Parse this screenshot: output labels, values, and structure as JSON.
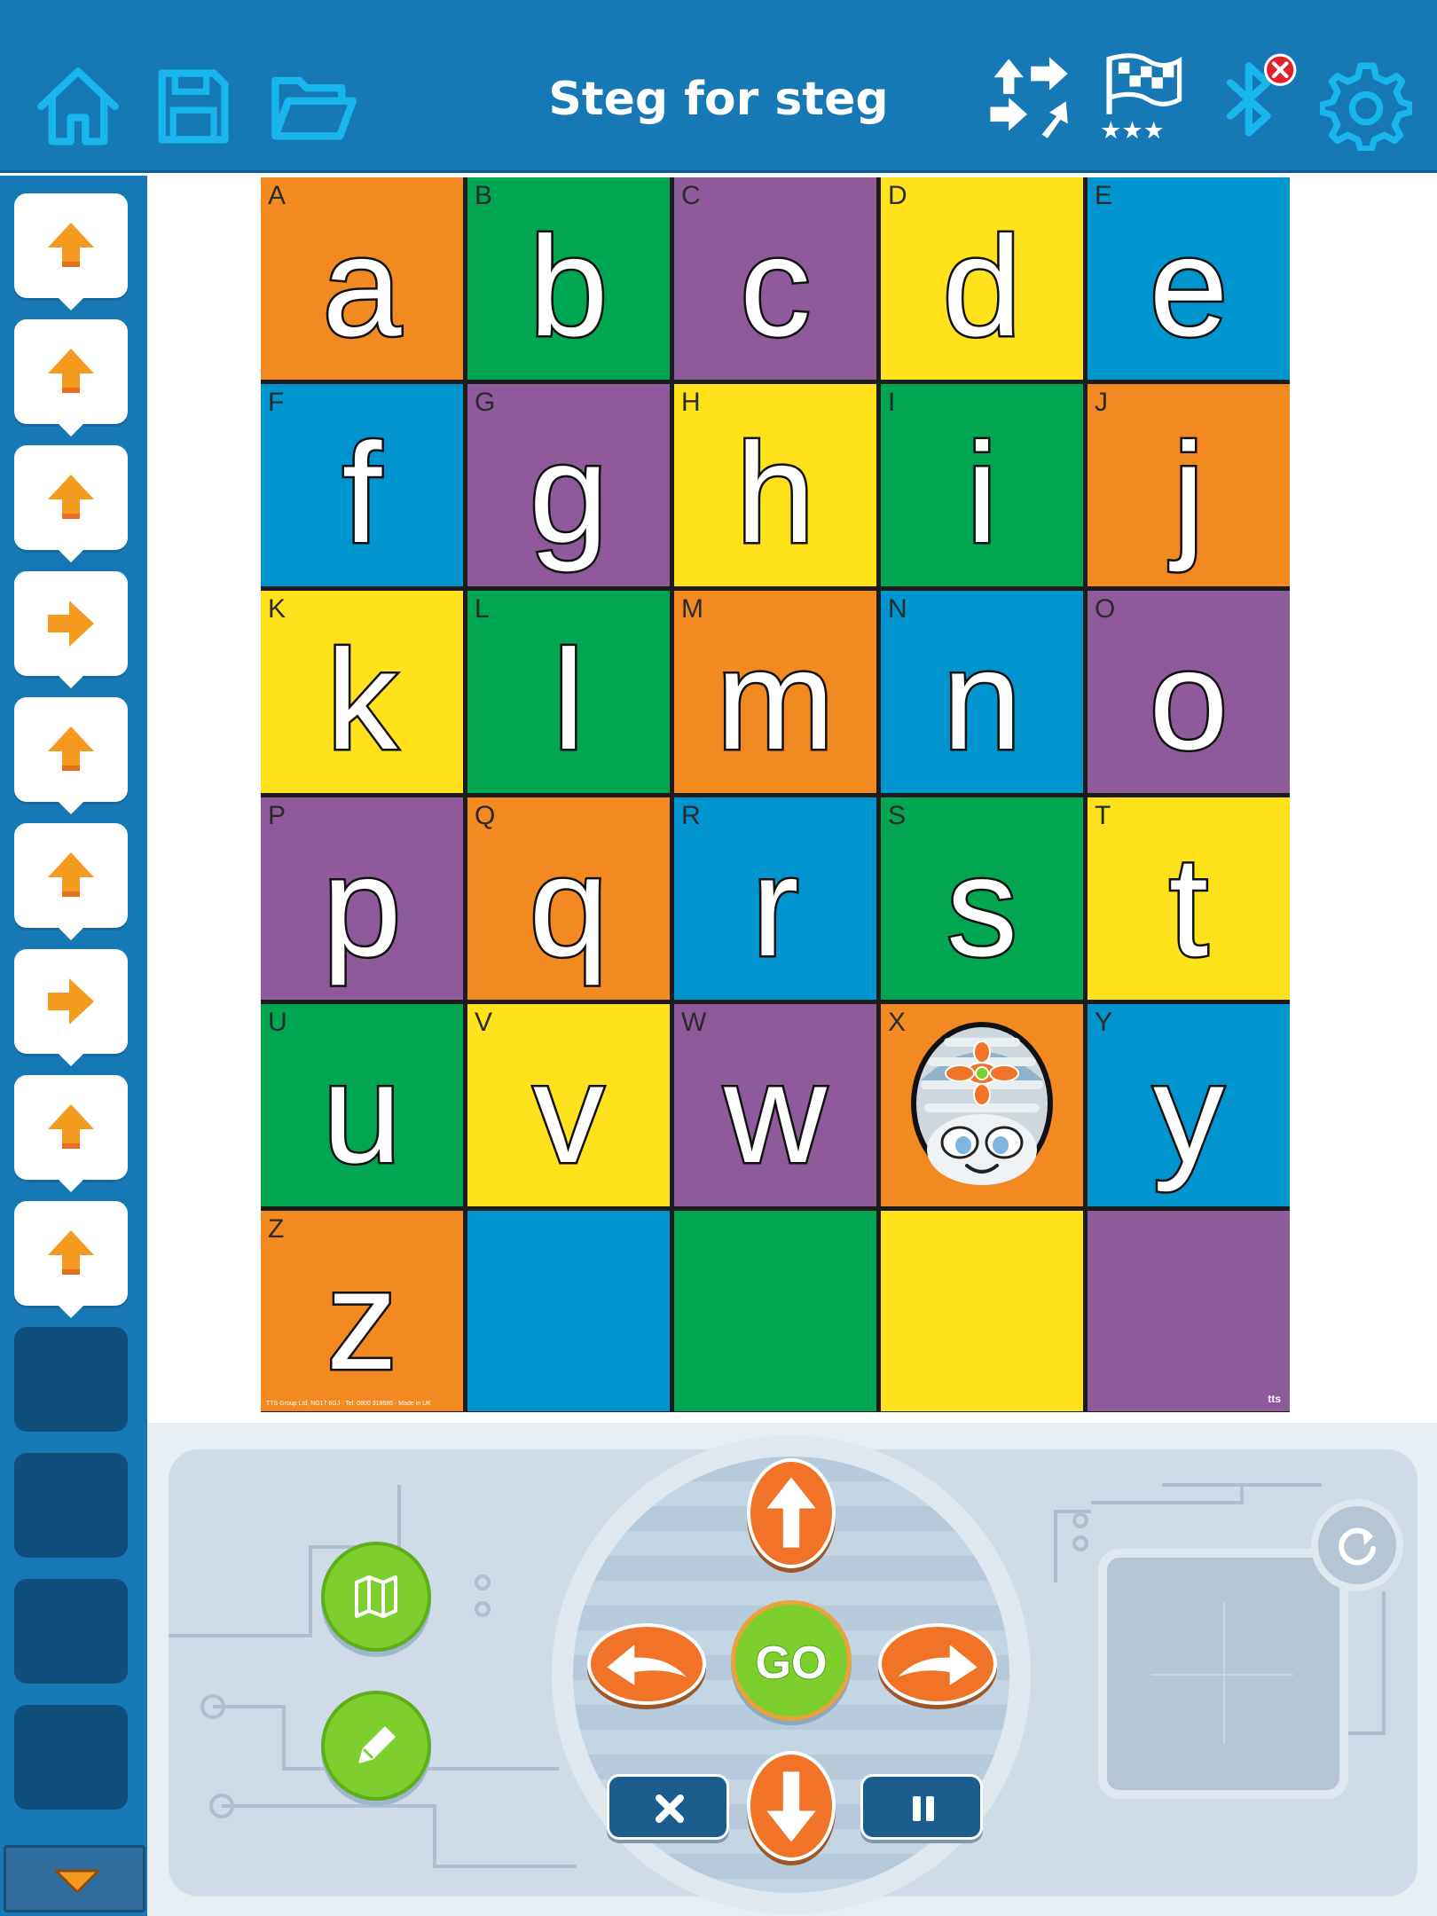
{
  "app": {
    "title": "Steg for steg"
  },
  "toolbar": {
    "left_icons": [
      "home-icon",
      "save-icon",
      "folder-icon"
    ],
    "right_icons": [
      "randomize-moves-icon",
      "challenge-flag-icon",
      "bluetooth-icon",
      "settings-icon"
    ],
    "bluetooth_status": "disconnected",
    "accent": "#1778b6"
  },
  "program": {
    "steps": [
      "forward",
      "forward",
      "forward",
      "right",
      "forward",
      "forward",
      "right",
      "forward",
      "forward"
    ],
    "empty_slots": 4,
    "scroll_icon": "chevron-down-icon"
  },
  "mat": {
    "cells": [
      {
        "cap": "A",
        "low": "a",
        "color": "orange"
      },
      {
        "cap": "B",
        "low": "b",
        "color": "green"
      },
      {
        "cap": "C",
        "low": "c",
        "color": "purple"
      },
      {
        "cap": "D",
        "low": "d",
        "color": "yellow"
      },
      {
        "cap": "E",
        "low": "e",
        "color": "blue"
      },
      {
        "cap": "F",
        "low": "f",
        "color": "blue"
      },
      {
        "cap": "G",
        "low": "g",
        "color": "purple"
      },
      {
        "cap": "H",
        "low": "h",
        "color": "yellow"
      },
      {
        "cap": "I",
        "low": "i",
        "color": "green"
      },
      {
        "cap": "J",
        "low": "j",
        "color": "orange"
      },
      {
        "cap": "K",
        "low": "k",
        "color": "yellow"
      },
      {
        "cap": "L",
        "low": "l",
        "color": "green"
      },
      {
        "cap": "M",
        "low": "m",
        "color": "orange"
      },
      {
        "cap": "N",
        "low": "n",
        "color": "blue"
      },
      {
        "cap": "O",
        "low": "o",
        "color": "purple"
      },
      {
        "cap": "P",
        "low": "p",
        "color": "purple"
      },
      {
        "cap": "Q",
        "low": "q",
        "color": "orange"
      },
      {
        "cap": "R",
        "low": "r",
        "color": "blue"
      },
      {
        "cap": "S",
        "low": "s",
        "color": "green"
      },
      {
        "cap": "T",
        "low": "t",
        "color": "yellow"
      },
      {
        "cap": "U",
        "low": "u",
        "color": "green"
      },
      {
        "cap": "V",
        "low": "v",
        "color": "yellow"
      },
      {
        "cap": "W",
        "low": "w",
        "color": "purple"
      },
      {
        "cap": "X",
        "low": "",
        "color": "orange"
      },
      {
        "cap": "Y",
        "low": "y",
        "color": "blue"
      },
      {
        "cap": "Z",
        "low": "z",
        "color": "orange"
      },
      {
        "cap": "",
        "low": "",
        "color": "blue"
      },
      {
        "cap": "",
        "low": "",
        "color": "green"
      },
      {
        "cap": "",
        "low": "",
        "color": "yellow"
      },
      {
        "cap": "",
        "low": "",
        "color": "purple"
      }
    ],
    "robot_cell": "X",
    "fine_print": "TTS Group Ltd, NG17 6GJ · Tel: 0800 318686 · Made in UK",
    "brand": "tts"
  },
  "controls": {
    "go_label": "GO",
    "left_buttons": [
      "map-icon",
      "pencil-icon"
    ],
    "dpad": [
      "arrow-up-icon",
      "turn-left-icon",
      "turn-right-icon",
      "arrow-down-icon"
    ],
    "clear_icon": "close-icon",
    "pause_icon": "pause-icon",
    "reset_icon": "reset-icon"
  }
}
